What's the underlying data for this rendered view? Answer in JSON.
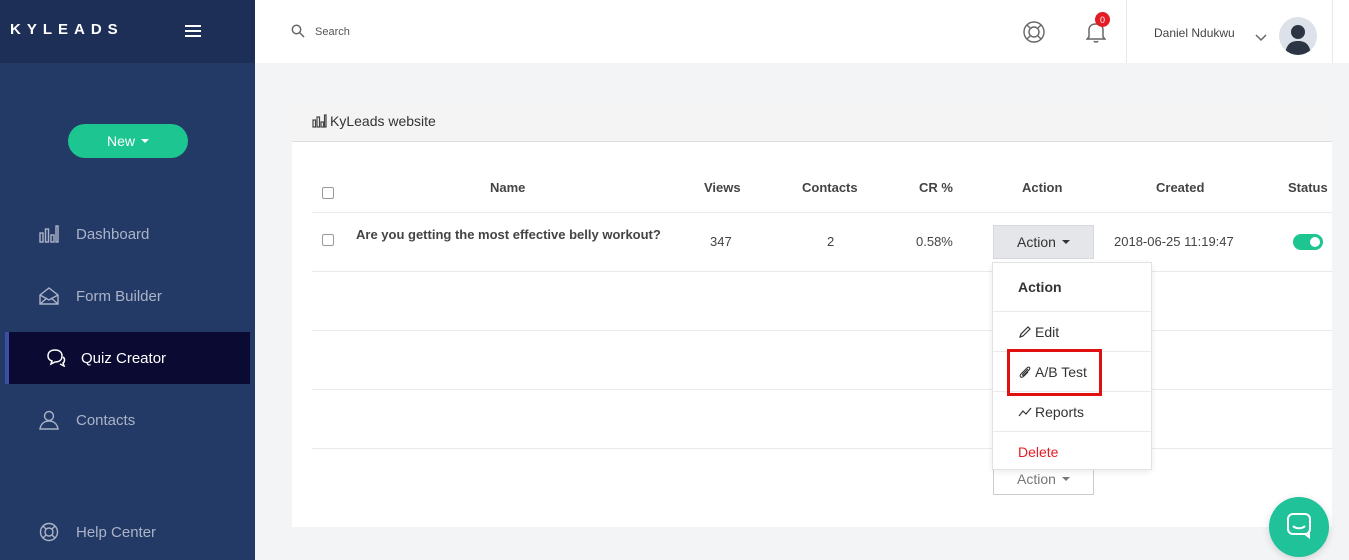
{
  "sidebar": {
    "logo": "KYLEADS",
    "new_button": "New",
    "items": [
      {
        "label": "Dashboard",
        "icon": "bar-chart-icon"
      },
      {
        "label": "Form Builder",
        "icon": "envelope-open-icon"
      },
      {
        "label": "Quiz Creator",
        "icon": "chat-bubbles-icon"
      },
      {
        "label": "Contacts",
        "icon": "user-icon"
      },
      {
        "label": "Help Center",
        "icon": "lifebuoy-icon"
      }
    ]
  },
  "topbar": {
    "search_placeholder": "Search",
    "notification_count": "0",
    "user_name": "Daniel Ndukwu"
  },
  "panel": {
    "title": "KyLeads website",
    "columns": [
      "Name",
      "Views",
      "Contacts",
      "CR %",
      "Action",
      "Created",
      "Status"
    ],
    "row": {
      "name": "Are you getting the most effective belly workout?",
      "views": "347",
      "contacts": "2",
      "cr": "0.58%",
      "action": "Action",
      "created": "2018-06-25 11:19:47"
    },
    "second_action": "Action"
  },
  "dropdown": {
    "header": "Action",
    "items": [
      "Edit",
      "A/B Test",
      "Reports",
      "Delete"
    ]
  },
  "colors": {
    "sidebar": "#243a66",
    "accent": "#1dc690",
    "danger": "#e51c23"
  }
}
